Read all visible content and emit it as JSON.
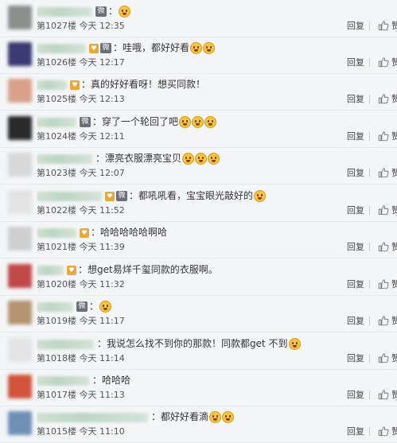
{
  "comments": [
    {
      "floor": "第1027楼",
      "time": "今天 12:35",
      "text": "",
      "emojis": 1,
      "badge": false,
      "vip": true,
      "avatar": "#8c8f8c",
      "name_w": 70
    },
    {
      "floor": "第1026楼",
      "time": "今天 12:17",
      "text": "哇哦，都好好看",
      "emojis": 2,
      "badge": true,
      "vip": true,
      "avatar": "#3b3a72",
      "name_w": 62
    },
    {
      "floor": "第1025楼",
      "time": "今天 12:13",
      "text": "真的好好看呀！想买同款！",
      "emojis": 0,
      "badge": true,
      "vip": false,
      "avatar": "#d9a18a",
      "name_w": 38
    },
    {
      "floor": "第1024楼",
      "time": "今天 12:11",
      "text": "穿了一个轮回了吧",
      "emojis": 3,
      "badge": false,
      "vip": true,
      "avatar": "#2a2a2a",
      "name_w": 50
    },
    {
      "floor": "第1023楼",
      "time": "今天 12:07",
      "text": "漂亮衣服漂亮宝贝",
      "emojis": 3,
      "badge": false,
      "vip": false,
      "avatar": "#d8d8d8",
      "name_w": 70
    },
    {
      "floor": "第1022楼",
      "time": "今天 11:52",
      "text": "都吼吼看，宝宝眼光敲好的",
      "emojis": 1,
      "badge": true,
      "vip": true,
      "avatar": "#e3e3e3",
      "name_w": 82
    },
    {
      "floor": "第1021楼",
      "time": "今天 11:39",
      "text": "哈哈哈哈哈啊哈",
      "emojis": 0,
      "badge": true,
      "vip": false,
      "avatar": "#cfcfcf",
      "name_w": 50
    },
    {
      "floor": "第1020楼",
      "time": "今天 11:32",
      "text": "想get易烊千玺同款的衣服啊。",
      "emojis": 0,
      "badge": true,
      "vip": false,
      "avatar": "#c04848",
      "name_w": 34
    },
    {
      "floor": "第1019楼",
      "time": "今天 11:17",
      "text": "",
      "emojis": 1,
      "badge": false,
      "vip": true,
      "avatar": "#b59471",
      "name_w": 46
    },
    {
      "floor": "第1018楼",
      "time": "今天 11:14",
      "text": "我说怎么找不到你的那款！同款都get 不到",
      "emojis": 1,
      "badge": false,
      "vip": false,
      "avatar": "#e4e4e4",
      "name_w": 72
    },
    {
      "floor": "第1017楼",
      "time": "今天 11:13",
      "text": "哈哈哈",
      "emojis": 0,
      "badge": false,
      "vip": false,
      "avatar": "#d2543c",
      "name_w": 66
    },
    {
      "floor": "第1015楼",
      "time": "今天 11:10",
      "text": "都好好看滴",
      "emojis": 2,
      "badge": false,
      "vip": false,
      "avatar": "#6f8fb5",
      "name_w": 140
    }
  ],
  "actions": {
    "reply": "回复",
    "like_count": "赞"
  },
  "icons": {
    "like": "thumbs-up-icon",
    "emoji": "emoji-icon",
    "vip": "vip-badge-icon",
    "badge": "member-badge-icon"
  }
}
